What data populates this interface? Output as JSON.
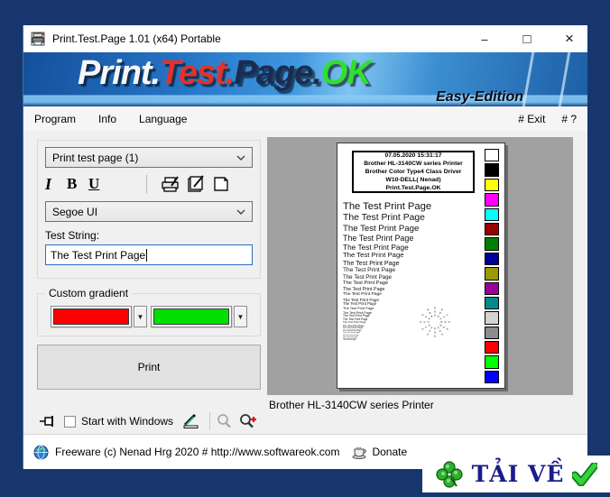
{
  "window": {
    "title": "Print.Test.Page 1.01  (x64) Portable",
    "minimize_glyph": "–",
    "maximize_glyph": "□",
    "close_glyph": "×"
  },
  "banner": {
    "part1": "Print.",
    "part2": "Test.",
    "part3": "Page.",
    "part4": "OK",
    "edition": "Easy-Edition"
  },
  "menu": {
    "items": [
      {
        "label": "Program"
      },
      {
        "label": "Info"
      },
      {
        "label": "Language"
      }
    ],
    "right": [
      {
        "label": "# Exit"
      },
      {
        "label": "# ?"
      }
    ]
  },
  "left_panel": {
    "test_page_select": "Print test page (1)",
    "format": {
      "italic": "I",
      "bold": "B",
      "underline": "U"
    },
    "font_select": "Segoe UI",
    "test_string_label": "Test String:",
    "test_string_value": "The Test Print Page",
    "gradient_group_label": "Custom gradient",
    "gradient1_color": "#ff0000",
    "gradient2_color": "#00e000",
    "dropdown_arrow_glyph": "▼",
    "print_button": "Print",
    "start_with_windows_label": "Start with Windows"
  },
  "preview": {
    "header_lines": [
      "07.05.2020 15:31:17",
      "Brother HL-3140CW series Printer",
      "Brother Color Type4 Class Driver",
      "W10-DELL( Nenad)",
      "Print.Test.Page.OK"
    ],
    "test_line": "The Test Print Page",
    "test_line_count": 27,
    "color_bars": [
      "#ffffff",
      "#000000",
      "#ffff00",
      "#ff00ff",
      "#00ffff",
      "#990000",
      "#008000",
      "#000099",
      "#999900",
      "#990099",
      "#008b8b",
      "#d3d3d3",
      "#8c8c8c",
      "#ff0000",
      "#00ff00",
      "#0000ff"
    ],
    "printer_label": "Brother HL-3140CW series Printer"
  },
  "statusbar": {
    "freeware_text": "Freeware (c) Nenad Hrg 2020 # http://www.softwareok.com",
    "donate_label": "Donate"
  },
  "badge": {
    "label": "TẢI VỀ"
  },
  "icons": {
    "app": "printer-app-icon",
    "toolbar": [
      "print-icon",
      "page-setup-icon",
      "new-page-icon"
    ],
    "pin": "pin-icon",
    "pencil": "edit-pencil-icon",
    "zoom_out": "zoom-icon",
    "zoom_in": "zoom-plus-icon",
    "globe": "globe-icon",
    "cup": "donate-cup-icon",
    "clover": "clover-icon",
    "check": "checkmark-icon"
  },
  "colors": {
    "focus_border": "#2f6fc1",
    "window_backdrop": "#17366e",
    "preview_bg": "#a1a1a1"
  }
}
